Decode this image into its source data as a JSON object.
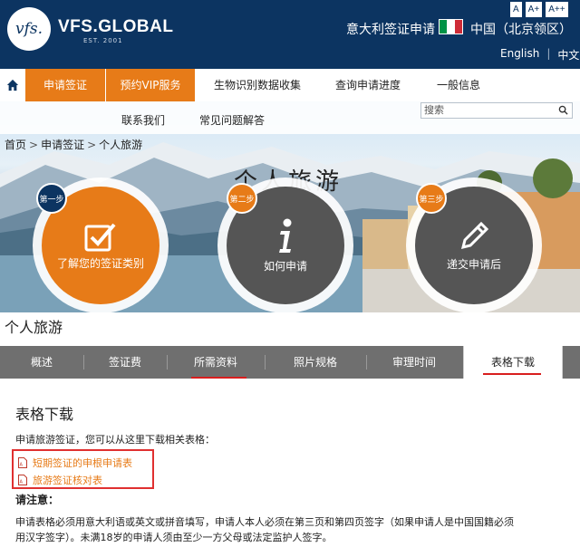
{
  "header": {
    "logo_text": "vfs.",
    "brand": "VFS.GLOBAL",
    "brand_sub": "EST. 2001",
    "font_sizes": [
      "A",
      "A+",
      "A++"
    ],
    "site_title": "意大利签证申请",
    "country": "中国（北京领区）",
    "lang_english": "English",
    "lang_separator": "|",
    "lang_chinese": "中文",
    "flag_colors": [
      "#009246",
      "#ffffff",
      "#ce2b37"
    ]
  },
  "nav": {
    "items": [
      "申请签证",
      "预约VIP服务",
      "生物识别数据收集",
      "查询申请进度",
      "一般信息"
    ],
    "row2": [
      "联系我们",
      "常见问题解答"
    ],
    "search_placeholder": "搜索"
  },
  "breadcrumb": [
    "首页",
    "申请签证",
    "个人旅游"
  ],
  "hero": {
    "title": "个人旅游",
    "steps": [
      {
        "badge": "第一步",
        "label": "了解您的签证类别",
        "color": "#e77b18",
        "badge_color": "#0c3461"
      },
      {
        "badge": "第二步",
        "label": "如何申请",
        "color": "#555555",
        "badge_color": "#e77b18"
      },
      {
        "badge": "第三步",
        "label": "递交申请后",
        "color": "#555555",
        "badge_color": "#e77b18"
      }
    ]
  },
  "page": {
    "heading": "个人旅游",
    "tabs": [
      "概述",
      "签证费",
      "所需资料",
      "照片规格",
      "审理时间",
      "表格下载"
    ],
    "active_tab": "表格下载",
    "section_title": "表格下载",
    "intro": "申请旅游签证，您可以从这里下载相关表格：",
    "documents": [
      "短期签证的申根申请表",
      "旅游签证核对表"
    ],
    "note_title": "请注意：",
    "note_line1": "申请表格必须用意大利语或英文或拼音填写，申请人本人必须在第三页和第四页签字（如果申请人是中国国籍必须",
    "note_line2": "用汉字签字）。未满18岁的申请人须由至少一方父母或法定监护人签字。"
  },
  "colors": {
    "navy": "#0c3461",
    "orange": "#e77b18",
    "tab_gray": "#6f6f6f",
    "highlight_red": "#d81e1e"
  }
}
